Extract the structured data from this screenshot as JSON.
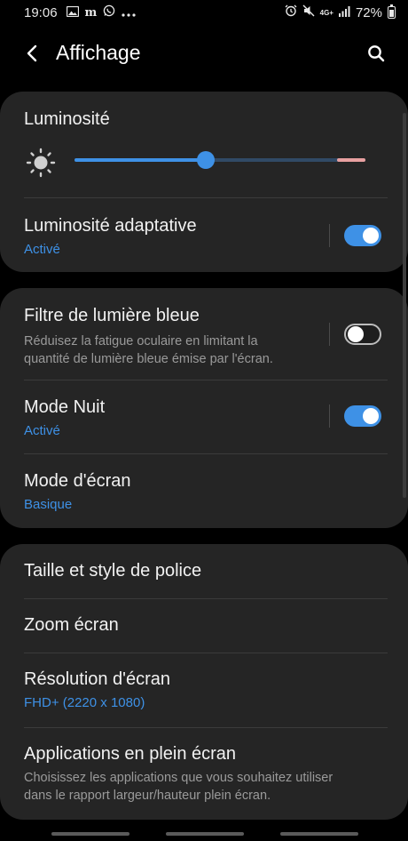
{
  "status_bar": {
    "time": "19:06",
    "left_icons": [
      "gallery-icon",
      "m-app-icon",
      "whatsapp-icon",
      "more-dots-icon"
    ],
    "right_icons": [
      "alarm-icon",
      "mute-icon",
      "4g-plus-icon",
      "signal-icon"
    ],
    "network_label": "4G+",
    "battery": "72%"
  },
  "app_bar": {
    "title": "Affichage"
  },
  "brightness": {
    "label": "Luminosité",
    "level_fraction": 0.45
  },
  "adaptive_brightness": {
    "title": "Luminosité adaptative",
    "status": "Activé",
    "enabled": true
  },
  "blue_light_filter": {
    "title": "Filtre de lumière bleue",
    "description_line1": "Réduisez la fatigue oculaire en limitant la",
    "description_line2": "quantité de lumière bleue émise par l'écran.",
    "enabled": false
  },
  "night_mode": {
    "title": "Mode Nuit",
    "status": "Activé",
    "enabled": true
  },
  "screen_mode": {
    "title": "Mode d'écran",
    "value": "Basique"
  },
  "font_size_style": {
    "title": "Taille et style de police"
  },
  "screen_zoom": {
    "title": "Zoom écran"
  },
  "screen_resolution": {
    "title": "Résolution d'écran",
    "value": "FHD+ (2220 x 1080)"
  },
  "full_screen_apps": {
    "title": "Applications en plein écran",
    "description_line1": "Choisissez les applications que vous souhaitez utiliser",
    "description_line2": "dans le rapport largeur/hauteur plein écran."
  },
  "colors": {
    "background": "#000000",
    "card": "#252525",
    "accent": "#3e91e6",
    "secondary_text": "#9a9a9a"
  }
}
